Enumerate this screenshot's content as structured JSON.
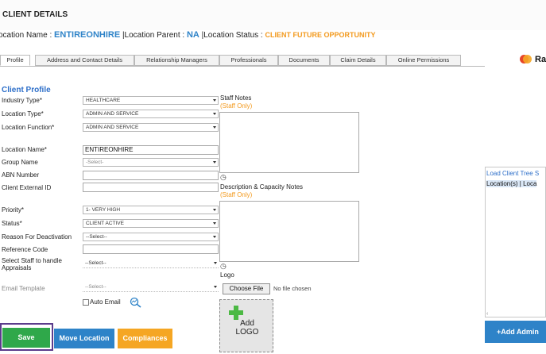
{
  "header": {
    "title": "CLIENT DETAILS",
    "location_name_label": "ocation Name :",
    "location_name_value": "ENTIREONHIRE",
    "location_parent_label": "|Location Parent :",
    "location_parent_value": "NA",
    "location_status_label": "|Location Status :",
    "location_status_value": "CLIENT FUTURE OPPORTUNITY"
  },
  "tabs": [
    {
      "label": "Profile",
      "active": true
    },
    {
      "label": "Address and Contact Details",
      "active": false
    },
    {
      "label": "Relationship Managers",
      "active": false
    },
    {
      "label": "Professionals",
      "active": false
    },
    {
      "label": "Documents",
      "active": false
    },
    {
      "label": "Claim Details",
      "active": false
    },
    {
      "label": "Online Permissions",
      "active": false
    }
  ],
  "brand": {
    "text": "Ra"
  },
  "profile": {
    "heading": "Client Profile",
    "industry_type": {
      "label": "Industry Type*",
      "value": "HEALTHCARE"
    },
    "location_type": {
      "label": "Location Type*",
      "value": "ADMIN AND SERVICE"
    },
    "location_function": {
      "label": "Location Function*",
      "value": "ADMIN AND SERVICE"
    },
    "location_name": {
      "label": "Location Name*",
      "value": "ENTIREONHIRE"
    },
    "group_name": {
      "label": "Group Name",
      "value": "-Select-"
    },
    "abn_number": {
      "label": "ABN Number",
      "value": ""
    },
    "client_external_id": {
      "label": "Client External ID",
      "value": ""
    },
    "priority": {
      "label": "Priority*",
      "value": "1- VERY HIGH"
    },
    "status": {
      "label": "Status*",
      "value": "CLIENT ACTIVE"
    },
    "reason_deactivation": {
      "label": "Reason For Deactivation",
      "value": "--Select--"
    },
    "reference_code": {
      "label": "Reference Code",
      "value": ""
    },
    "staff_appraisals": {
      "label_line1": "Select Staff to handle",
      "label_line2": "Appraisals",
      "value": "--Select--"
    },
    "email_template": {
      "label": "Email Template",
      "value": "--Select--"
    },
    "auto_email": {
      "label": "Auto Email"
    }
  },
  "notes": {
    "staff_notes_label": "Staff Notes",
    "staff_only_1": "(Staff Only)",
    "desc_label": "Description & Capacity Notes",
    "staff_only_2": "(Staff Only)",
    "logo_label": "Logo",
    "choose_file": "Choose File",
    "no_file": "No file chosen",
    "add_logo_line1": "Add",
    "add_logo_line2": "LOGO"
  },
  "buttons": {
    "save": "Save",
    "move_location": "Move Location",
    "compliances": "Compliances"
  },
  "tree": {
    "link": "Load Client Tree S",
    "sub": "Location(s) | Loca",
    "add_admin": "+Add Admin"
  },
  "colors": {
    "accent_blue": "#2e83c8",
    "heading_blue": "#2e6fc9",
    "orange": "#f39a1e",
    "save_green": "#2fa84a",
    "compliances_orange": "#f5a623",
    "focus_purple": "#5b3c8c"
  }
}
